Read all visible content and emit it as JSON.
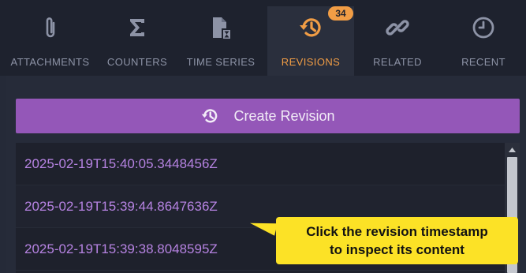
{
  "tabs": [
    {
      "label": "ATTACHMENTS",
      "icon": "paperclip-icon",
      "active": false
    },
    {
      "label": "COUNTERS",
      "icon": "sigma-icon",
      "active": false
    },
    {
      "label": "TIME SERIES",
      "icon": "timeseries-icon",
      "active": false
    },
    {
      "label": "REVISIONS",
      "icon": "revision-history-icon",
      "active": true,
      "badge": "34"
    },
    {
      "label": "RELATED",
      "icon": "link-icon",
      "active": false
    },
    {
      "label": "RECENT",
      "icon": "clock-icon",
      "active": false
    }
  ],
  "create_revision_label": "Create Revision",
  "revisions": [
    "2025-02-19T15:40:05.3448456Z",
    "2025-02-19T15:39:44.8647636Z",
    "2025-02-19T15:39:38.8048595Z"
  ],
  "tooltip": {
    "line1": "Click the revision timestamp",
    "line2": "to inspect its content"
  },
  "colors": {
    "accent_orange": "#f19d45",
    "purple_button": "#9457b8",
    "revision_link": "#b683e2",
    "tooltip_yellow": "#fce226"
  }
}
